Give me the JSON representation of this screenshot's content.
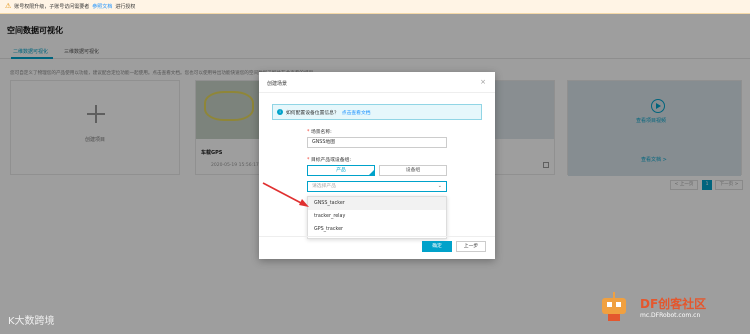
{
  "notice": {
    "text": "账号权限升级，子账号访问需要者",
    "link": "参照文档",
    "suffix": "进行授权"
  },
  "page": {
    "title": "空间数据可视化",
    "tabs": [
      "二维数据可视化",
      "三维数据可视化"
    ],
    "description": "您可自定义了物理您的产品使用以功能，建议配合定位功能一起使用。点击查看文档。您也可以使用导出功能快速您的空间数据了解并在此查看的结果。"
  },
  "cards": {
    "new_label": "创建项目",
    "project_name": "车载GPS",
    "project_date": "2020-05-19 15:56:17",
    "demo_play": "查看项目视频",
    "demo_link": "查看文档 >"
  },
  "pager": {
    "prev": "< 上一页",
    "current": "1",
    "next": "下一页 >"
  },
  "modal": {
    "title": "创建场景",
    "close": "×",
    "info_question": "如何配置设备位置信息？",
    "info_link": "点击查看文档",
    "field_name_label": "场景名称:",
    "field_name_value": "GNSS地图",
    "field_source_label": "目标产品或设备组:",
    "seg_product": "产品",
    "seg_group": "设备组",
    "select_placeholder": "请选择产品",
    "options": [
      "GNSS_tacker",
      "tracker_relay",
      "GPS_tracker"
    ],
    "ok": "确定",
    "back": "上一步"
  },
  "watermark": {
    "left": "K大数跨境",
    "right_brand": "DF创客社区",
    "right_url": "mc.DFRobot.com.cn"
  },
  "colors": {
    "accent": "#00a2ca",
    "link": "#1890ff",
    "warning": "#e08a00",
    "arrow": "#e03030"
  }
}
